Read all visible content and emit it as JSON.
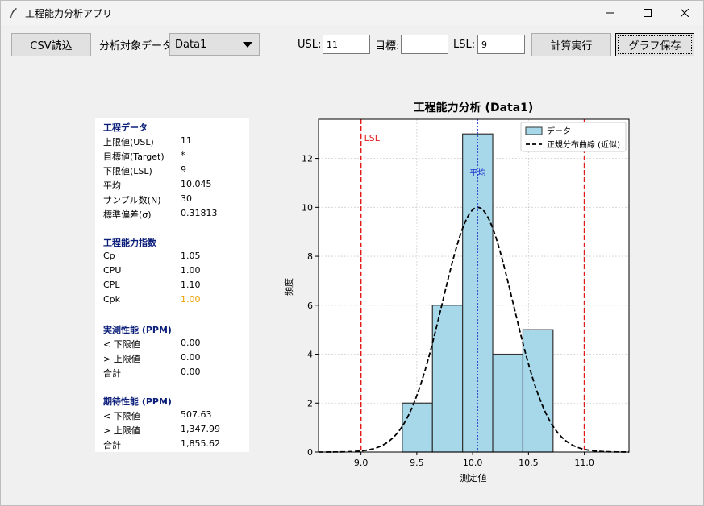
{
  "window": {
    "title": "工程能力分析アプリ",
    "controls": {
      "minimize": "—",
      "maximize": "☐",
      "close": "✕"
    }
  },
  "toolbar": {
    "csv_button": "CSV読込",
    "target_label": "分析対象データ:",
    "target_value": "Data1",
    "usl_label": "USL:",
    "usl_value": "11",
    "target_spec_label": "目標:",
    "target_spec_value": "",
    "lsl_label": "LSL:",
    "lsl_value": "9",
    "calc_button": "計算実行",
    "save_button": "グラフ保存"
  },
  "panel": {
    "sections": [
      {
        "title": "工程データ",
        "rows": [
          {
            "key": "上限値(USL)",
            "value": "11"
          },
          {
            "key": "目標値(Target)",
            "value": "*"
          },
          {
            "key": "下限値(LSL)",
            "value": "9"
          },
          {
            "key": "平均",
            "value": "10.045"
          },
          {
            "key": "サンプル数(N)",
            "value": "30"
          },
          {
            "key": "標準偏差(σ)",
            "value": "0.31813"
          }
        ]
      },
      {
        "title": "工程能力指数",
        "rows": [
          {
            "key": "Cp",
            "value": "1.05"
          },
          {
            "key": "CPU",
            "value": "1.00"
          },
          {
            "key": "CPL",
            "value": "1.10"
          },
          {
            "key": "Cpk",
            "value": "1.00",
            "highlight": true
          }
        ]
      },
      {
        "title": "実測性能 (PPM)",
        "rows": [
          {
            "key": "< 下限値",
            "value": "0.00"
          },
          {
            "key": "> 上限値",
            "value": "0.00"
          },
          {
            "key": "合計",
            "value": "0.00"
          }
        ]
      },
      {
        "title": "期待性能 (PPM)",
        "rows": [
          {
            "key": "< 下限値",
            "value": "507.63"
          },
          {
            "key": "> 上限値",
            "value": "1,347.99"
          },
          {
            "key": "合計",
            "value": "1,855.62"
          }
        ]
      }
    ]
  },
  "chart_data": {
    "type": "bar",
    "title": "工程能力分析 (Data1)",
    "xlabel": "測定値",
    "ylabel": "頻度",
    "xlim": [
      8.62,
      11.4
    ],
    "ylim": [
      0,
      13.6
    ],
    "xticks": [
      9.0,
      9.5,
      10.0,
      10.5,
      11.0
    ],
    "yticks": [
      0,
      2,
      4,
      6,
      8,
      10,
      12
    ],
    "grid": true,
    "legend_position": "top-right",
    "bins": [
      {
        "x0": 9.37,
        "x1": 9.64,
        "count": 2
      },
      {
        "x0": 9.64,
        "x1": 9.91,
        "count": 6
      },
      {
        "x0": 9.91,
        "x1": 10.18,
        "count": 13
      },
      {
        "x0": 10.18,
        "x1": 10.45,
        "count": 4
      },
      {
        "x0": 10.45,
        "x1": 10.72,
        "count": 5
      }
    ],
    "normal_curve": {
      "mean": 10.045,
      "peak": 10.0,
      "sigma": 0.31813
    },
    "lsl": 9.0,
    "usl": 11.0,
    "mean": 10.045,
    "lsl_label": "LSL",
    "mean_label": "平均",
    "legend": [
      {
        "label": "データ"
      },
      {
        "label": "正規分布曲線 (近似)"
      }
    ],
    "colors": {
      "bar_fill": "#a6d8ea",
      "bar_edge": "#333333",
      "curve": "#000000",
      "spec_line": "#e31b1b",
      "mean_line": "#2233cc"
    }
  }
}
